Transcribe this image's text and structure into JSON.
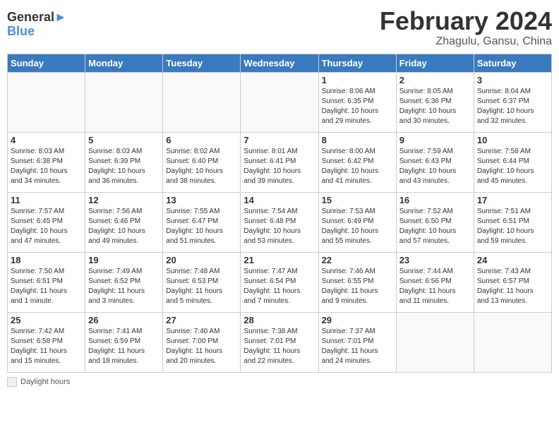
{
  "header": {
    "logo_line1": "General",
    "logo_line2": "Blue",
    "month_title": "February 2024",
    "location": "Zhagulu, Gansu, China"
  },
  "days_of_week": [
    "Sunday",
    "Monday",
    "Tuesday",
    "Wednesday",
    "Thursday",
    "Friday",
    "Saturday"
  ],
  "weeks": [
    [
      {
        "day": "",
        "info": ""
      },
      {
        "day": "",
        "info": ""
      },
      {
        "day": "",
        "info": ""
      },
      {
        "day": "",
        "info": ""
      },
      {
        "day": "1",
        "info": "Sunrise: 8:06 AM\nSunset: 6:35 PM\nDaylight: 10 hours\nand 29 minutes."
      },
      {
        "day": "2",
        "info": "Sunrise: 8:05 AM\nSunset: 6:36 PM\nDaylight: 10 hours\nand 30 minutes."
      },
      {
        "day": "3",
        "info": "Sunrise: 8:04 AM\nSunset: 6:37 PM\nDaylight: 10 hours\nand 32 minutes."
      }
    ],
    [
      {
        "day": "4",
        "info": "Sunrise: 8:03 AM\nSunset: 6:38 PM\nDaylight: 10 hours\nand 34 minutes."
      },
      {
        "day": "5",
        "info": "Sunrise: 8:03 AM\nSunset: 6:39 PM\nDaylight: 10 hours\nand 36 minutes."
      },
      {
        "day": "6",
        "info": "Sunrise: 8:02 AM\nSunset: 6:40 PM\nDaylight: 10 hours\nand 38 minutes."
      },
      {
        "day": "7",
        "info": "Sunrise: 8:01 AM\nSunset: 6:41 PM\nDaylight: 10 hours\nand 39 minutes."
      },
      {
        "day": "8",
        "info": "Sunrise: 8:00 AM\nSunset: 6:42 PM\nDaylight: 10 hours\nand 41 minutes."
      },
      {
        "day": "9",
        "info": "Sunrise: 7:59 AM\nSunset: 6:43 PM\nDaylight: 10 hours\nand 43 minutes."
      },
      {
        "day": "10",
        "info": "Sunrise: 7:58 AM\nSunset: 6:44 PM\nDaylight: 10 hours\nand 45 minutes."
      }
    ],
    [
      {
        "day": "11",
        "info": "Sunrise: 7:57 AM\nSunset: 6:45 PM\nDaylight: 10 hours\nand 47 minutes."
      },
      {
        "day": "12",
        "info": "Sunrise: 7:56 AM\nSunset: 6:46 PM\nDaylight: 10 hours\nand 49 minutes."
      },
      {
        "day": "13",
        "info": "Sunrise: 7:55 AM\nSunset: 6:47 PM\nDaylight: 10 hours\nand 51 minutes."
      },
      {
        "day": "14",
        "info": "Sunrise: 7:54 AM\nSunset: 6:48 PM\nDaylight: 10 hours\nand 53 minutes."
      },
      {
        "day": "15",
        "info": "Sunrise: 7:53 AM\nSunset: 6:49 PM\nDaylight: 10 hours\nand 55 minutes."
      },
      {
        "day": "16",
        "info": "Sunrise: 7:52 AM\nSunset: 6:50 PM\nDaylight: 10 hours\nand 57 minutes."
      },
      {
        "day": "17",
        "info": "Sunrise: 7:51 AM\nSunset: 6:51 PM\nDaylight: 10 hours\nand 59 minutes."
      }
    ],
    [
      {
        "day": "18",
        "info": "Sunrise: 7:50 AM\nSunset: 6:51 PM\nDaylight: 11 hours\nand 1 minute."
      },
      {
        "day": "19",
        "info": "Sunrise: 7:49 AM\nSunset: 6:52 PM\nDaylight: 11 hours\nand 3 minutes."
      },
      {
        "day": "20",
        "info": "Sunrise: 7:48 AM\nSunset: 6:53 PM\nDaylight: 11 hours\nand 5 minutes."
      },
      {
        "day": "21",
        "info": "Sunrise: 7:47 AM\nSunset: 6:54 PM\nDaylight: 11 hours\nand 7 minutes."
      },
      {
        "day": "22",
        "info": "Sunrise: 7:46 AM\nSunset: 6:55 PM\nDaylight: 11 hours\nand 9 minutes."
      },
      {
        "day": "23",
        "info": "Sunrise: 7:44 AM\nSunset: 6:56 PM\nDaylight: 11 hours\nand 11 minutes."
      },
      {
        "day": "24",
        "info": "Sunrise: 7:43 AM\nSunset: 6:57 PM\nDaylight: 11 hours\nand 13 minutes."
      }
    ],
    [
      {
        "day": "25",
        "info": "Sunrise: 7:42 AM\nSunset: 6:58 PM\nDaylight: 11 hours\nand 15 minutes."
      },
      {
        "day": "26",
        "info": "Sunrise: 7:41 AM\nSunset: 6:59 PM\nDaylight: 11 hours\nand 18 minutes."
      },
      {
        "day": "27",
        "info": "Sunrise: 7:40 AM\nSunset: 7:00 PM\nDaylight: 11 hours\nand 20 minutes."
      },
      {
        "day": "28",
        "info": "Sunrise: 7:38 AM\nSunset: 7:01 PM\nDaylight: 11 hours\nand 22 minutes."
      },
      {
        "day": "29",
        "info": "Sunrise: 7:37 AM\nSunset: 7:01 PM\nDaylight: 11 hours\nand 24 minutes."
      },
      {
        "day": "",
        "info": ""
      },
      {
        "day": "",
        "info": ""
      }
    ]
  ],
  "legend": {
    "box_label": "Daylight hours"
  }
}
